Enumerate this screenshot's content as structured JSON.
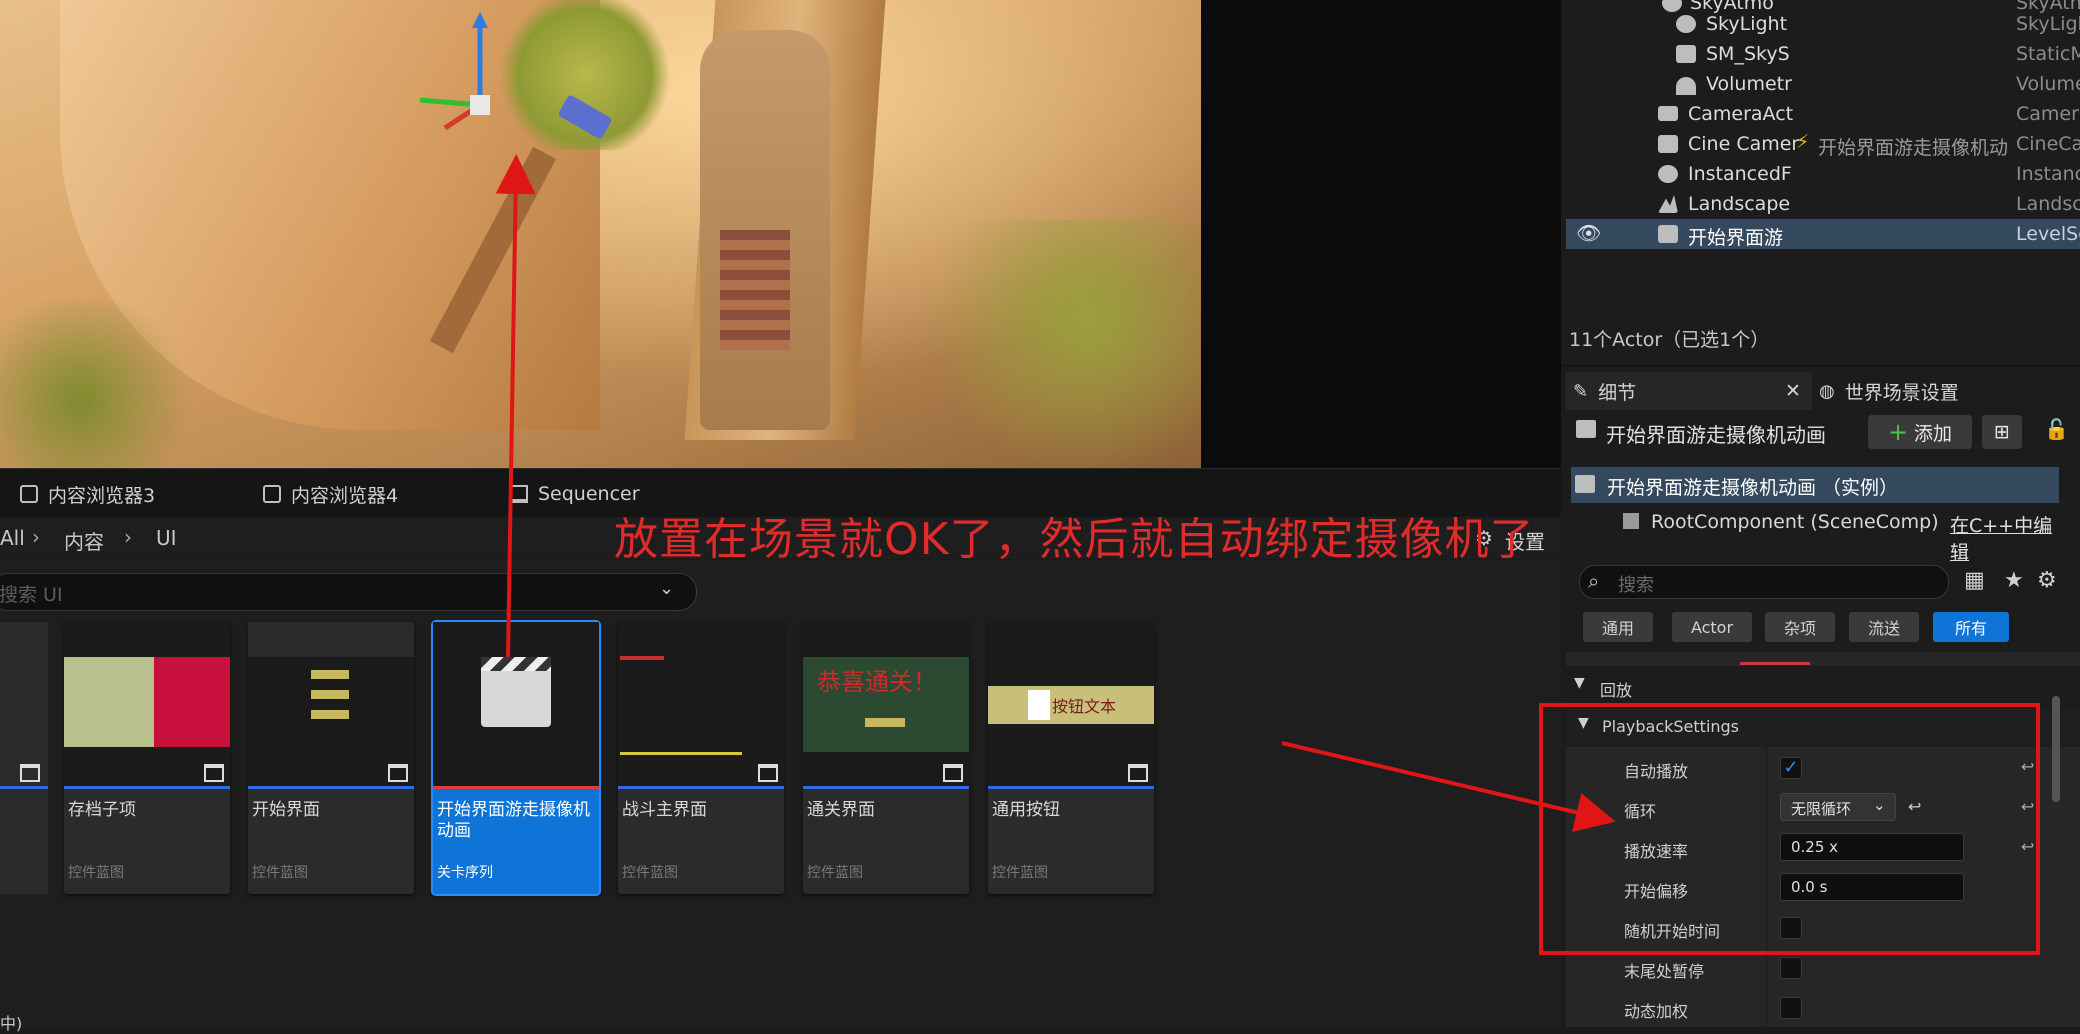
{
  "content_browser": {
    "tabs": [
      {
        "label": "内容浏览器3"
      },
      {
        "label": "内容浏览器4"
      },
      {
        "label": "Sequencer"
      }
    ],
    "breadcrumb": [
      "All",
      "内容",
      "UI"
    ],
    "search_placeholder": "搜索 UI",
    "settings_label": "设置",
    "assets": [
      {
        "name": "存档子项",
        "type": "控件蓝图"
      },
      {
        "name": "开始界面",
        "type": "控件蓝图"
      },
      {
        "name": "开始界面游走摄像机动画",
        "type": "关卡序列",
        "selected": true
      },
      {
        "name": "战斗主界面",
        "type": "控件蓝图"
      },
      {
        "name": "通关界面",
        "type": "控件蓝图"
      },
      {
        "name": "通用按钮",
        "type": "控件蓝图"
      }
    ],
    "thumb_texts": {
      "congrats": "恭喜通关！",
      "button_text": "按钮文本"
    },
    "bottom_fragment": "中)"
  },
  "outliner": {
    "rows": [
      {
        "name": "SkyAtmo",
        "type": "SkyAtm"
      },
      {
        "name": "SkyLight",
        "type": "SkyLigh"
      },
      {
        "name": "SM_SkyS",
        "type": "StaticM"
      },
      {
        "name": "Volumetr",
        "type": "Volume"
      },
      {
        "name": "CameraAct",
        "type": "Camera"
      },
      {
        "name": "Cine Camer",
        "type": "CineCa",
        "extra": "开始界面游走摄像机动"
      },
      {
        "name": "InstancedF",
        "type": "Instanc"
      },
      {
        "name": "Landscape",
        "type": "Landsc"
      },
      {
        "name": "开始界面游",
        "type": "LevelSe",
        "selected": true
      }
    ],
    "status": "11个Actor（已选1个）"
  },
  "details": {
    "tab_details": "细节",
    "tab_world": "世界场景设置",
    "actor_title": "开始界面游走摄像机动画",
    "add_label": "添加",
    "instance_label": "开始界面游走摄像机动画 （实例）",
    "root_component": "RootComponent (SceneComp)",
    "edit_cpp": "在C++中编辑",
    "search_placeholder": "搜索",
    "filters": [
      "通用",
      "Actor",
      "杂项",
      "流送",
      "所有"
    ],
    "sections": {
      "playback": "回放",
      "playback_settings": "PlaybackSettings"
    },
    "props": [
      {
        "label": "自动播放",
        "kind": "checkbox",
        "checked": true
      },
      {
        "label": "循环",
        "kind": "dropdown",
        "value": "无限循环"
      },
      {
        "label": "播放速率",
        "kind": "text",
        "value": "0.25 x"
      },
      {
        "label": "开始偏移",
        "kind": "text",
        "value": "0.0 s"
      },
      {
        "label": "随机开始时间",
        "kind": "checkbox",
        "checked": false
      },
      {
        "label": "末尾处暂停",
        "kind": "checkbox",
        "checked": false
      },
      {
        "label": "动态加权",
        "kind": "checkbox",
        "checked": false
      }
    ]
  },
  "annotation": {
    "text": "放置在场景就OK了，然后就自动绑定摄像机了",
    "color": "#e02b2b"
  }
}
